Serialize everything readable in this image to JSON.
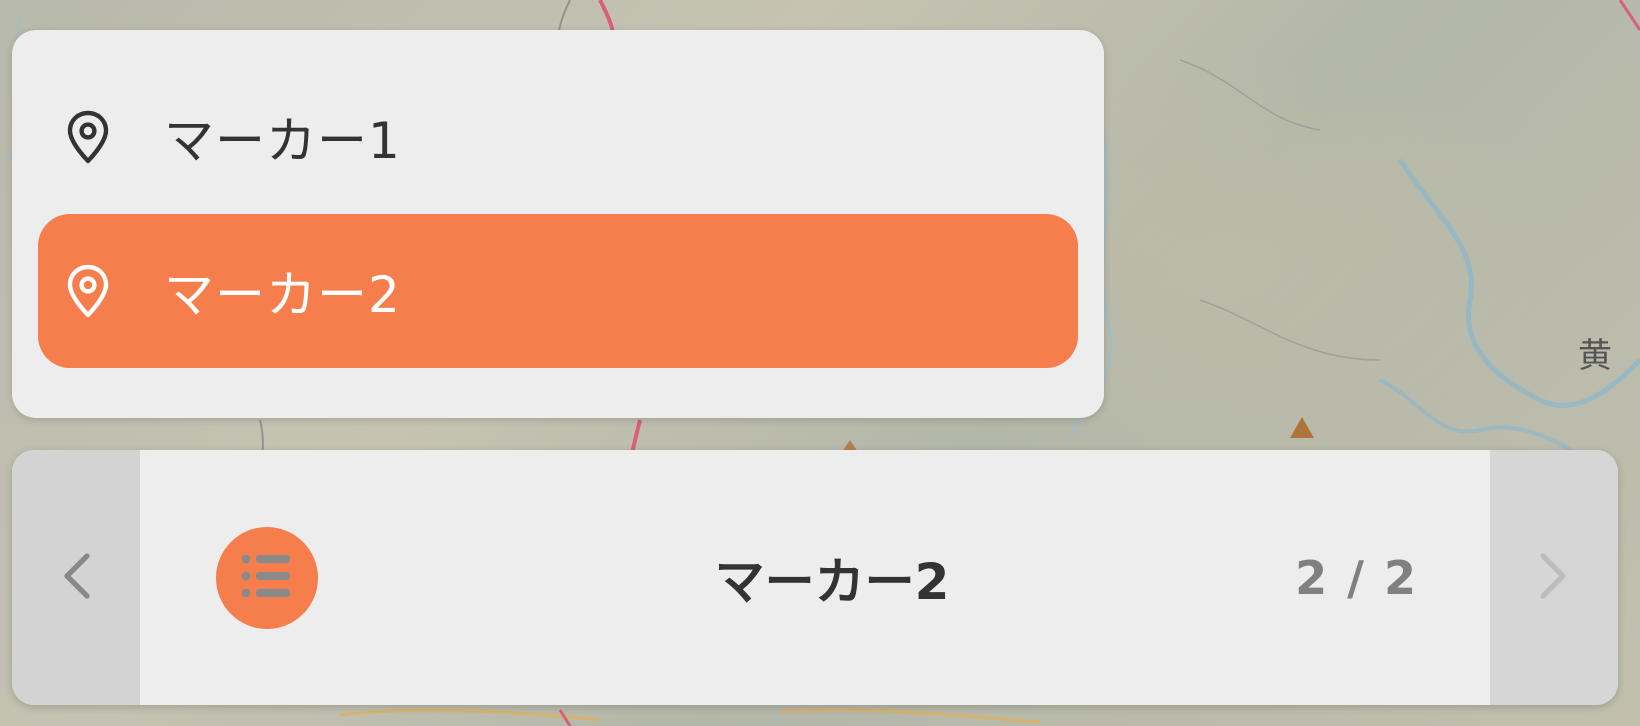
{
  "map": {
    "place_label": "黄"
  },
  "marker_list": {
    "items": [
      {
        "label": "マーカー1",
        "icon": "map-pin-icon",
        "selected": false
      },
      {
        "label": "マーカー2",
        "icon": "map-pin-icon",
        "selected": true
      }
    ]
  },
  "navigator": {
    "current_title": "マーカー2",
    "counter": "2 / 2",
    "prev_icon": "chevron-left-icon",
    "next_icon": "chevron-right-icon",
    "list_icon": "list-icon"
  },
  "colors": {
    "accent": "#f57e4c",
    "panel": "#ededed",
    "text": "#333333",
    "muted": "#808080"
  }
}
